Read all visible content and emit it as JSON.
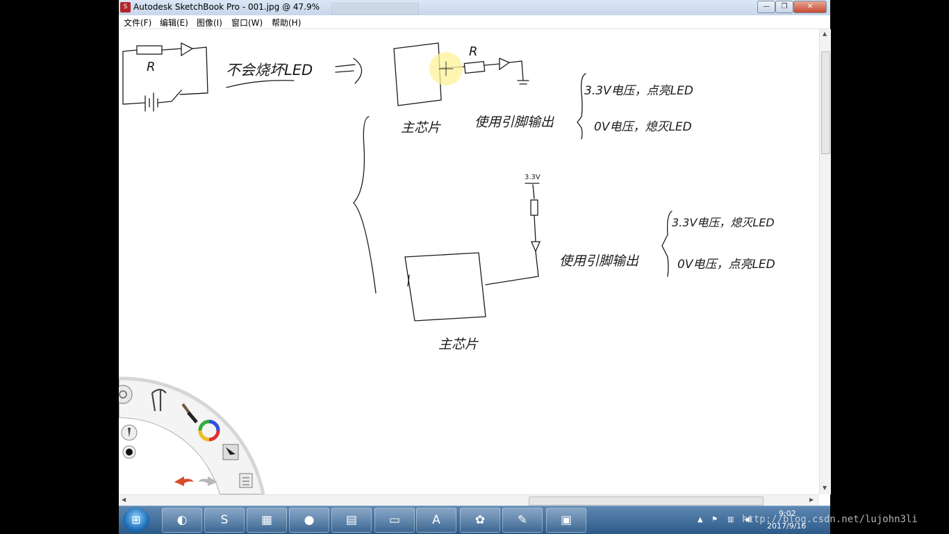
{
  "window": {
    "title": "Autodesk SketchBook Pro - 001.jpg @ 47.9%",
    "app_icon": "sketchbook-icon",
    "controls": {
      "minimize": "—",
      "maximize": "❐",
      "close": "✕"
    }
  },
  "menu": [
    {
      "label": "文件(F)"
    },
    {
      "label": "编辑(E)"
    },
    {
      "label": "图像(I)"
    },
    {
      "label": "窗口(W)"
    },
    {
      "label": "帮助(H)"
    }
  ],
  "sketch": {
    "top_left": {
      "resistor_label": "R",
      "note": "不会烧坏LED"
    },
    "top_right": {
      "resistor_label": "R",
      "chip_label": "主芯片",
      "output_label": "使用引脚输出",
      "case_high": "3.3V电压，点亮LED",
      "case_low": "0V电压，熄灭LED"
    },
    "bottom": {
      "supply_label": "3.3V",
      "chip_label": "主芯片",
      "output_label": "使用引脚输出",
      "case_high": "3.3V电压，熄灭LED",
      "case_low": "0V电压，点亮LED"
    }
  },
  "lagoon_toolbar": {
    "tools": [
      "settings-icon",
      "pen-icon",
      "brush-icon",
      "color-wheel-icon",
      "pencil-icon",
      "brush-size-icon",
      "select-icon",
      "undo-icon",
      "redo-icon",
      "layers-icon"
    ]
  },
  "taskbar": {
    "start": "start-icon",
    "apps": [
      {
        "name": "ie-icon",
        "glyph": "◐"
      },
      {
        "name": "sketchbook-app-icon",
        "glyph": "S"
      },
      {
        "name": "vmware-icon",
        "glyph": "▦"
      },
      {
        "name": "firefox-icon",
        "glyph": "●"
      },
      {
        "name": "calculator-icon",
        "glyph": "▤"
      },
      {
        "name": "folder-icon",
        "glyph": "▭"
      },
      {
        "name": "acrobat-icon",
        "glyph": "A"
      },
      {
        "name": "baidu-netdisk-icon",
        "glyph": "✿"
      },
      {
        "name": "chart-tool-icon",
        "glyph": "✎"
      },
      {
        "name": "photo-viewer-icon",
        "glyph": "▣"
      }
    ],
    "clock": {
      "time": "9:02",
      "date": "2017/9/16"
    }
  },
  "watermark": "http://blog.csdn.net/lujohn3li"
}
